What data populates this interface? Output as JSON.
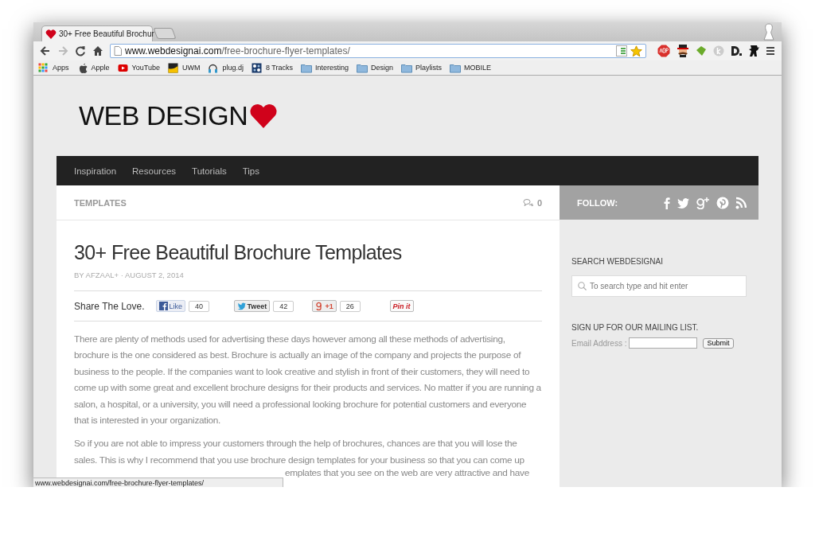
{
  "browser": {
    "tab": {
      "title": "30+ Free Beautiful Brochur",
      "selected": true
    },
    "forward": {
      "disabled": true
    },
    "url": {
      "domain": "www.webdesignai.com",
      "path": "/free-brochure-flyer-templates/"
    },
    "bookmarks": [
      {
        "kind": "apps",
        "label": "Apps"
      },
      {
        "kind": "apple",
        "label": "Apple"
      },
      {
        "kind": "youtube",
        "label": "YouTube"
      },
      {
        "kind": "uwm",
        "label": "UWM"
      },
      {
        "kind": "headphones",
        "label": "plug.dj"
      },
      {
        "kind": "tracks",
        "label": "8 Tracks"
      },
      {
        "kind": "folder",
        "label": "Interesting"
      },
      {
        "kind": "folder",
        "label": "Design"
      },
      {
        "kind": "folder",
        "label": "Playlists"
      },
      {
        "kind": "folder",
        "label": "MOBILE"
      }
    ],
    "status_url": "www.webdesignai.com/free-brochure-flyer-templates/"
  },
  "page": {
    "logo": "WEB DESIGN",
    "nav": [
      {
        "label": "Inspiration"
      },
      {
        "label": "Resources"
      },
      {
        "label": "Tutorials"
      },
      {
        "label": "Tips"
      }
    ],
    "category": "TEMPLATES",
    "comment_count": "0",
    "follow_label": "FOLLOW:",
    "follow_icons": [
      {
        "kind": "facebook"
      },
      {
        "kind": "twitter"
      },
      {
        "kind": "gplus"
      },
      {
        "kind": "pinterest"
      },
      {
        "kind": "rss"
      }
    ],
    "article": {
      "title": "30+ Free Beautiful Brochure Templates",
      "meta": "BY AFZAAL+ · AUGUST 2, 2014",
      "share_label": "Share The Love.",
      "share": [
        {
          "kind": "facebook",
          "label": "Like",
          "count": "40"
        },
        {
          "kind": "twitter",
          "label": "Tweet",
          "count": "42"
        },
        {
          "kind": "gplus",
          "label": "+1",
          "count": "26"
        },
        {
          "kind": "pinterest",
          "label": "Pin it"
        }
      ],
      "paragraphs": [
        "There are plenty of methods used for advertising these days however among all these methods of advertising, brochure is the one considered as best. Brochure is actually an image of the company and projects the purpose of business to the people. If the companies want to look creative and stylish in front of their customers, they will need to come up with some great and excellent brochure designs for their products and services. No matter if you are running a salon, a hospital, or a university, you will need a professional looking brochure for potential customers and everyone that is interested in your organization.",
        "So if you are not able to impress your customers through the help of brochures, chances are that you will lose the sales. This is why I recommend that you use brochure design templates for your business so that you can come up"
      ],
      "fragment": "emplates that you see on the web are very attractive and have"
    },
    "sidebar": {
      "search_heading": "SEARCH WEBDESIGNAI",
      "search_placeholder": "To search type and hit enter",
      "mailing_heading": "SIGN UP FOR OUR MAILING LIST.",
      "email_label": "Email Address :",
      "submit": "Submit"
    }
  }
}
